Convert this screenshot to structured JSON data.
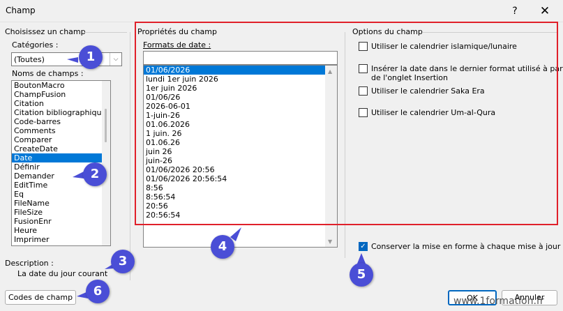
{
  "window": {
    "title": "Champ",
    "help_glyph": "?",
    "close_glyph": "✕"
  },
  "left": {
    "choose_label": "Choisissez un champ",
    "categories_label": "Catégories :",
    "categories_value": "(Toutes)",
    "field_names_label": "Noms de champs :",
    "fields": [
      "BoutonMacro",
      "ChampFusion",
      "Citation",
      "Citation bibliographique",
      "Code-barres",
      "Comments",
      "Comparer",
      "CreateDate",
      "Date",
      "Définir",
      "Demander",
      "EditTime",
      "Eq",
      "FileName",
      "FileSize",
      "FusionEnr",
      "Heure",
      "Imprimer"
    ],
    "selected_field": "Date",
    "description_label": "Description :",
    "description_text": "La date du jour courant",
    "field_codes_button": "Codes de champ"
  },
  "properties": {
    "title": "Propriétés du champ",
    "formats_label": "Formats de date :",
    "format_input": "",
    "formats": [
      "01/06/2026",
      "lundi 1er juin 2026",
      "1er juin 2026",
      "01/06/26",
      "2026-06-01",
      "1-juin-26",
      "01.06.2026",
      "1 juin. 26",
      "01.06.26",
      "juin 26",
      "juin-26",
      "01/06/2026 20:56",
      "01/06/2026 20:56:54",
      "8:56",
      "8:56:54",
      "20:56",
      "20:56:54"
    ],
    "selected_format": "01/06/2026"
  },
  "options": {
    "title": "Options du champ",
    "items": [
      {
        "label": "Utiliser le calendrier islamique/lunaire",
        "checked": false
      },
      {
        "label": "Insérer la date dans le dernier format utilisé à partir",
        "label2": "de l'onglet Insertion",
        "checked": false
      },
      {
        "label": "Utiliser le calendrier Saka Era",
        "checked": false
      },
      {
        "label": "Utiliser le calendrier Um-al-Qura",
        "checked": false
      }
    ],
    "preserve_label": "Conserver la mise en forme à chaque mise à jour",
    "preserve_checked": true
  },
  "footer": {
    "ok_label": "OK",
    "cancel_label": "Annuler"
  },
  "badges": [
    "1",
    "2",
    "3",
    "4",
    "5",
    "6"
  ],
  "watermark": "www.1formation.fr",
  "colors": {
    "highlight": "#e0202a",
    "badge": "#4a4ed6",
    "selection": "#0078d7"
  }
}
